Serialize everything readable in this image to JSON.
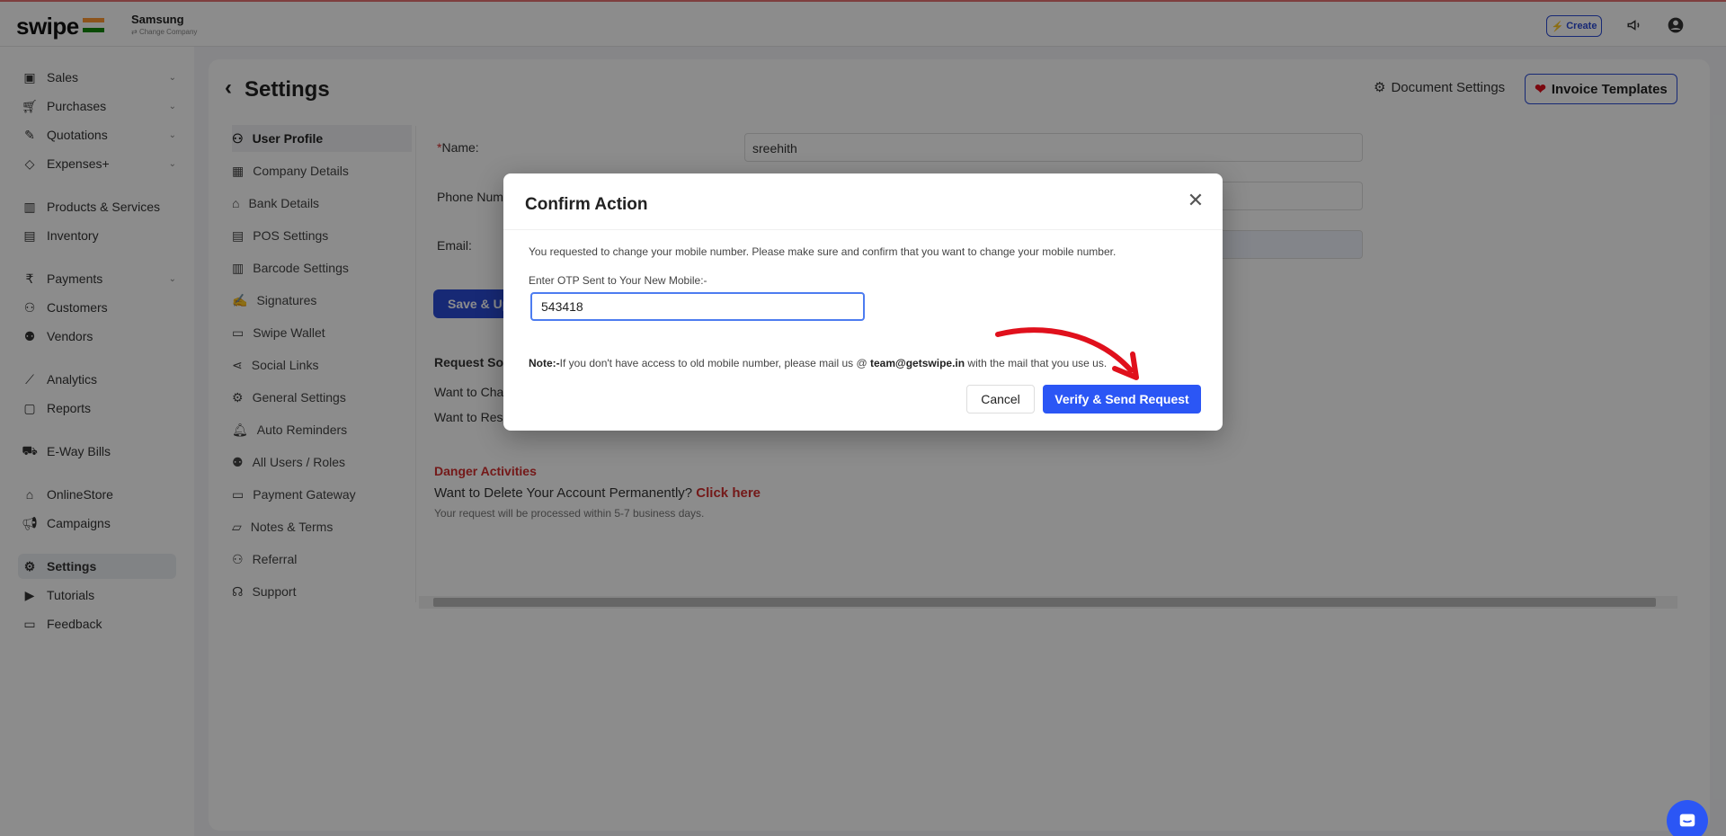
{
  "app": {
    "logo": "swipe",
    "company_name": "Samsung",
    "change_company": "Change Company",
    "create_label": "Create"
  },
  "sidebar": {
    "items": [
      {
        "label": "Sales",
        "icon": "banknote-icon",
        "has_chevron": true
      },
      {
        "label": "Purchases",
        "icon": "cart-icon",
        "has_chevron": true
      },
      {
        "label": "Quotations",
        "icon": "pen-icon",
        "has_chevron": true
      },
      {
        "label": "Expenses+",
        "icon": "tag-icon",
        "has_chevron": true
      },
      {
        "label": "Products & Services",
        "icon": "barcode-icon",
        "has_chevron": false
      },
      {
        "label": "Inventory",
        "icon": "warehouse-icon",
        "has_chevron": false
      },
      {
        "label": "Payments",
        "icon": "rupee-icon",
        "has_chevron": true
      },
      {
        "label": "Customers",
        "icon": "user-icon",
        "has_chevron": false
      },
      {
        "label": "Vendors",
        "icon": "users-icon",
        "has_chevron": false
      },
      {
        "label": "Analytics",
        "icon": "chart-icon",
        "has_chevron": false
      },
      {
        "label": "Reports",
        "icon": "report-icon",
        "has_chevron": false
      },
      {
        "label": "E-Way Bills",
        "icon": "truck-icon",
        "has_chevron": false
      },
      {
        "label": "OnlineStore",
        "icon": "store-icon",
        "has_chevron": false
      },
      {
        "label": "Campaigns",
        "icon": "megaphone-icon",
        "has_chevron": false
      },
      {
        "label": "Settings",
        "icon": "gear-icon",
        "has_chevron": false,
        "active": true
      },
      {
        "label": "Tutorials",
        "icon": "youtube-icon",
        "has_chevron": false
      },
      {
        "label": "Feedback",
        "icon": "comment-icon",
        "has_chevron": false
      }
    ]
  },
  "page": {
    "title": "Settings",
    "document_settings": "Document Settings",
    "invoice_templates": "Invoice Templates"
  },
  "settings_menu": [
    "User Profile",
    "Company Details",
    "Bank Details",
    "POS Settings",
    "Barcode Settings",
    "Signatures",
    "Swipe Wallet",
    "Social Links",
    "General Settings",
    "Auto Reminders",
    "All Users / Roles",
    "Payment Gateway",
    "Notes & Terms",
    "Referral",
    "Support"
  ],
  "profile": {
    "name_label": "Name:",
    "name_value": "sreehith",
    "phone_label": "Phone Num",
    "email_label": "Email:",
    "save_label": "Save & Up",
    "request_heading": "Request So",
    "want_change": "Want to Cha",
    "want_reset": "Want to Res",
    "danger_title": "Danger Activities",
    "danger_question": "Want to Delete Your Account Permanently?",
    "danger_link": "Click here",
    "danger_note": "Your request will be processed within 5-7 business days."
  },
  "modal": {
    "title": "Confirm Action",
    "message": "You requested to change your mobile number. Please make sure and confirm that you want to change your mobile number.",
    "otp_label": "Enter OTP Sent to Your New Mobile:-",
    "otp_value": "543418",
    "note_prefix": "Note:-",
    "note_text": "If you don't have access to old mobile number, please mail us @",
    "note_email": "team@getswipe.in",
    "note_suffix": "with the mail that you use us.",
    "cancel_label": "Cancel",
    "verify_label": "Verify & Send Request"
  },
  "colors": {
    "primary": "#2b56f5",
    "danger": "#d32f2f",
    "annotation_arrow": "#e0101c"
  }
}
